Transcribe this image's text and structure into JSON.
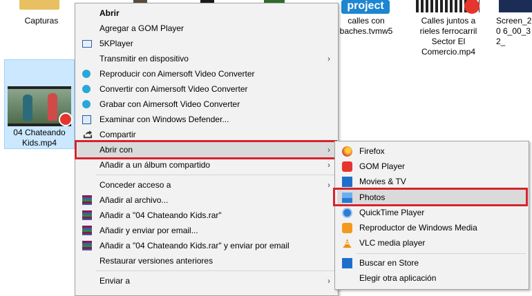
{
  "desktop": {
    "items": [
      {
        "label": "Capturas"
      },
      {
        "label": "calles con baches.tvmw5",
        "badge": "project"
      },
      {
        "label": "Calles juntos a rieles ferrocarril Sector El Comercio.mp4"
      },
      {
        "label": "Screen_20 6_00_32_"
      },
      {
        "label": "04 Chateando Kids.mp4"
      }
    ]
  },
  "context_menu": {
    "items": [
      {
        "label": "Abrir",
        "bold": true
      },
      {
        "label": "Agregar a GOM Player"
      },
      {
        "label": "5KPlayer",
        "icon": "5kplayer-icon"
      },
      {
        "label": "Transmitir en dispositivo",
        "submenu": true
      },
      {
        "label": "Reproducir con Aimersoft Video Converter",
        "icon": "aimersoft-icon"
      },
      {
        "label": "Convertir con Aimersoft Video Converter",
        "icon": "aimersoft-icon"
      },
      {
        "label": "Grabar con Aimersoft Video Converter",
        "icon": "aimersoft-icon"
      },
      {
        "label": "Examinar con Windows Defender...",
        "icon": "defender-icon"
      },
      {
        "label": "Compartir",
        "icon": "share-icon"
      },
      {
        "label": "Abrir con",
        "submenu": true
      },
      {
        "label": "Añadir a un álbum compartido",
        "submenu": true
      },
      {
        "label": "Conceder acceso a",
        "submenu": true
      },
      {
        "label": "Añadir al archivo...",
        "icon": "winrar-icon"
      },
      {
        "label": "Añadir a \"04 Chateando Kids.rar\"",
        "icon": "winrar-icon"
      },
      {
        "label": "Añadir y enviar por email...",
        "icon": "winrar-icon"
      },
      {
        "label": "Añadir a \"04 Chateando Kids.rar\" y enviar por email",
        "icon": "winrar-icon"
      },
      {
        "label": "Restaurar versiones anteriores"
      },
      {
        "label": "Enviar a",
        "submenu": true
      }
    ],
    "arrow": "›"
  },
  "open_with_menu": {
    "items": [
      {
        "label": "Firefox",
        "icon": "firefox-icon"
      },
      {
        "label": "GOM Player",
        "icon": "gom-player-icon"
      },
      {
        "label": "Movies & TV",
        "icon": "movies-tv-icon"
      },
      {
        "label": "Photos",
        "icon": "photos-icon"
      },
      {
        "label": "QuickTime Player",
        "icon": "quicktime-icon"
      },
      {
        "label": "Reproductor de Windows Media",
        "icon": "windows-media-icon"
      },
      {
        "label": "VLC media player",
        "icon": "vlc-icon"
      },
      {
        "label": "Buscar en Store",
        "icon": "store-icon"
      },
      {
        "label": "Elegir otra aplicación"
      }
    ]
  },
  "colors": {
    "highlight_border": "#d6232d",
    "menu_bg": "#f2f2f2",
    "selection_bg": "#cce8ff"
  }
}
